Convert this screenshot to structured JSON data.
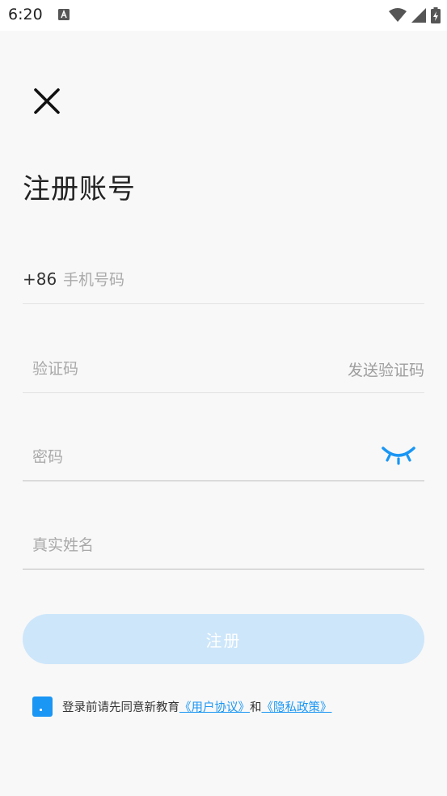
{
  "status_bar": {
    "time": "6:20",
    "notification_icon": "a-icon",
    "wifi_icon": "wifi-icon",
    "signal_icon": "signal-icon",
    "battery_icon": "battery-charging-icon"
  },
  "header": {
    "close_icon": "close-icon",
    "title": "注册账号"
  },
  "form": {
    "phone": {
      "country_code": "+86",
      "placeholder": "手机号码",
      "value": ""
    },
    "code": {
      "placeholder": "验证码",
      "value": "",
      "send_label": "发送验证码"
    },
    "password": {
      "placeholder": "密码",
      "value": "",
      "toggle_icon": "eye-closed-icon"
    },
    "name": {
      "placeholder": "真实姓名",
      "value": ""
    }
  },
  "actions": {
    "register_label": "注册"
  },
  "agreement": {
    "checked": true,
    "prefix": "登录前请先同意新教育",
    "user_agreement": "《用户协议》",
    "conjunction": "和",
    "privacy_policy": "《隐私政策》"
  },
  "colors": {
    "accent": "#1a96f4",
    "button_disabled": "#cde6fa",
    "background": "#f8f8f8"
  }
}
